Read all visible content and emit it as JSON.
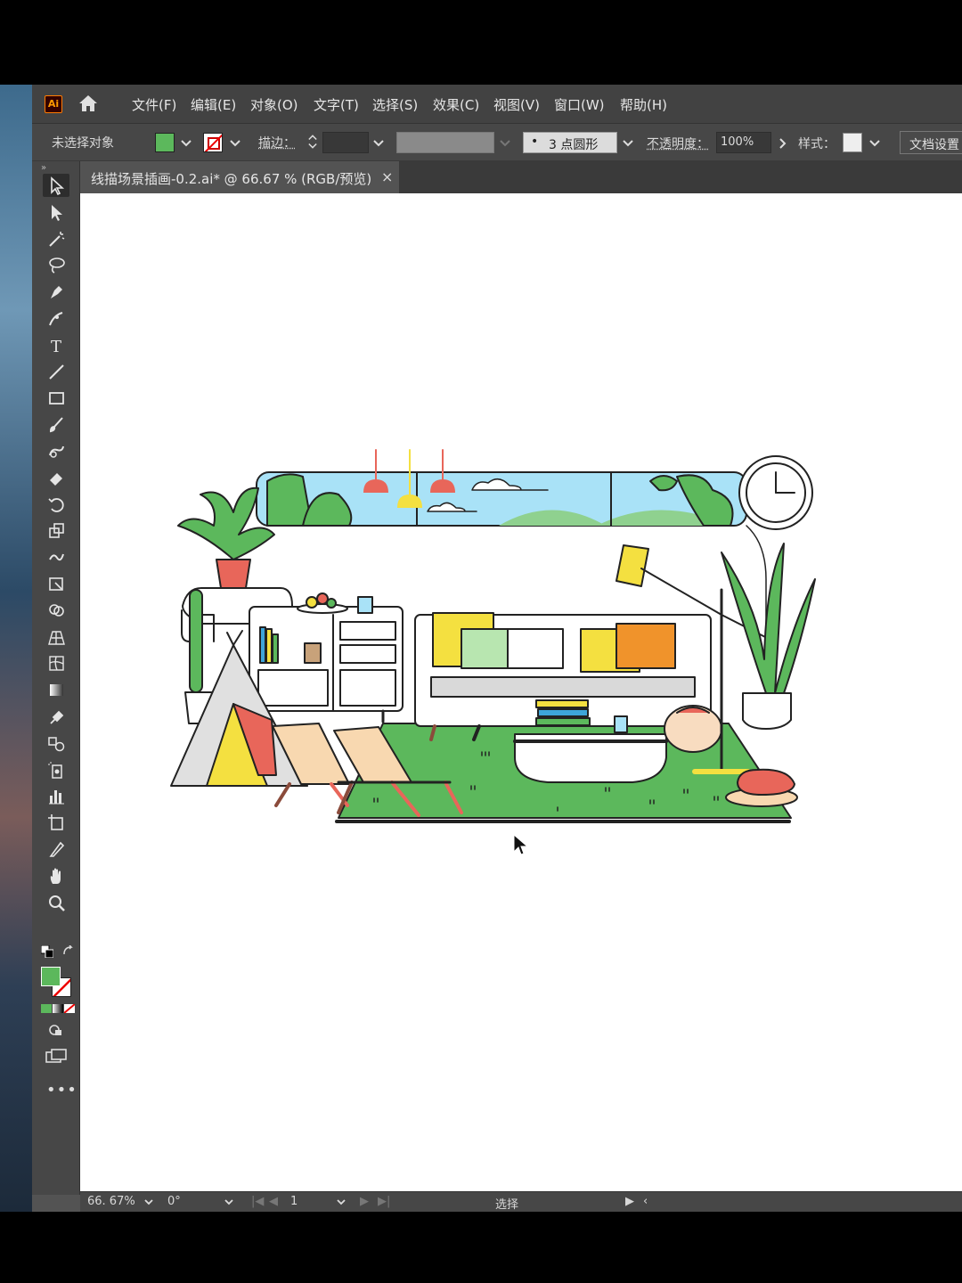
{
  "app": {
    "logo": "Ai",
    "menu": [
      "文件(F)",
      "编辑(E)",
      "对象(O)",
      "文字(T)",
      "选择(S)",
      "效果(C)",
      "视图(V)",
      "窗口(W)",
      "帮助(H)"
    ]
  },
  "control": {
    "selection_status": "未选择对象",
    "stroke_label": "描边：",
    "brush_label": "3 点圆形",
    "opacity_label": "不透明度：",
    "opacity_value": "100%",
    "style_label": "样式：",
    "doc_setup": "文档设置",
    "fill_color": "#5cb85c"
  },
  "document": {
    "tab_title": "线描场景插画-0.2.ai* @ 66.67 % (RGB/预览)",
    "close": "×"
  },
  "tools": [
    "selection-tool",
    "direct-selection-tool",
    "magic-wand-tool",
    "lasso-tool",
    "pen-tool",
    "curvature-tool",
    "type-tool",
    "line-tool",
    "rectangle-tool",
    "paintbrush-tool",
    "shaper-tool",
    "eraser-tool",
    "rotate-tool",
    "scale-tool",
    "warp-tool",
    "free-transform-tool",
    "shape-builder-tool",
    "perspective-grid-tool",
    "mesh-tool",
    "gradient-tool",
    "eyedropper-tool",
    "blend-tool",
    "symbol-sprayer-tool",
    "column-graph-tool",
    "artboard-tool",
    "slice-tool",
    "hand-tool",
    "zoom-tool"
  ],
  "status": {
    "zoom": "66. 67%",
    "rotation": "0°",
    "artboard": "1",
    "mode": "选择"
  }
}
